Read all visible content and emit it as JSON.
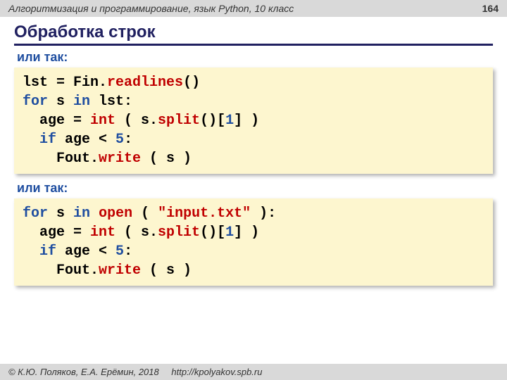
{
  "header": {
    "course": "Алгоритмизация и программирование, язык Python, 10 класс",
    "page": "164"
  },
  "title": "Обработка строк",
  "label1": "или так:",
  "label2": "или так:",
  "code1": {
    "l1a": "lst",
    "l1b": " = Fin.",
    "l1c": "readlines",
    "l1d": "()",
    "l2a": "for",
    "l2b": " s ",
    "l2c": "in",
    "l2d": " lst:",
    "l3a": "  age = ",
    "l3b": "int",
    "l3c": " ( s.",
    "l3d": "split",
    "l3e": "()[",
    "l3f": "1",
    "l3g": "] )",
    "l4a": "  ",
    "l4b": "if",
    "l4c": " age < ",
    "l4d": "5",
    "l4e": ":",
    "l5a": "    Fout.",
    "l5b": "write",
    "l5c": " ( s )"
  },
  "code2": {
    "l1a": "for",
    "l1b": " s ",
    "l1c": "in",
    "l1d": " ",
    "l1e": "open",
    "l1f": " ( ",
    "l1g": "\"input.txt\"",
    "l1h": " ):",
    "l2a": "  age = ",
    "l2b": "int",
    "l2c": " ( s.",
    "l2d": "split",
    "l2e": "()[",
    "l2f": "1",
    "l2g": "] )",
    "l3a": "  ",
    "l3b": "if",
    "l3c": " age < ",
    "l3d": "5",
    "l3e": ":",
    "l4a": "    Fout.",
    "l4b": "write",
    "l4c": " ( s )"
  },
  "footer": {
    "copyright": "© К.Ю. Поляков, Е.А. Ерёмин, 2018",
    "url": "http://kpolyakov.spb.ru"
  }
}
